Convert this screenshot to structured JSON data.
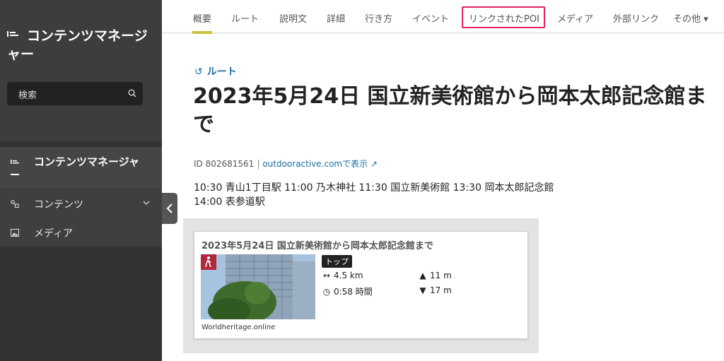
{
  "sidebar": {
    "title": "コンテンツマネージャー",
    "search_placeholder": "検索",
    "section_label": "コンテンツマネージャ",
    "items": [
      {
        "label": "コンテンツ",
        "icon": "content-icon"
      },
      {
        "label": "メディア",
        "icon": "image-icon"
      }
    ]
  },
  "tabs": [
    {
      "label": "概要",
      "active": true
    },
    {
      "label": "ルート"
    },
    {
      "label": "説明文"
    },
    {
      "label": "詳細"
    },
    {
      "label": "行き方"
    },
    {
      "label": "イベント"
    },
    {
      "label": "リンクされたPOI",
      "highlighted": true
    },
    {
      "label": "メディア"
    },
    {
      "label": "外部リンク"
    },
    {
      "label": "その他 ▾"
    }
  ],
  "main": {
    "back_label": "ルート",
    "title": "2023年5月24日 国立新美術館から岡本太郎記念館まで",
    "id_text": "ID 802681561",
    "external_link": "outdooractive.comで表示 ↗",
    "description": "10:30 青山1丁目駅 11:00 乃木神社 11:30 国立新美術館 13:30 岡本太郎記念館 14:00 表参道駅"
  },
  "card": {
    "title": "2023年5月24日 国立新美術館から岡本太郎記念館まで",
    "badge": "トップ",
    "distance": "4.5 km",
    "duration": "0:58 時間",
    "ascent": "11 m",
    "descent": "17 m",
    "credit": "Worldheritage.online"
  },
  "colors": {
    "sidebar_bg": "#333333",
    "link": "#1d6fa0",
    "active_tab_underline": "#c8c33c",
    "highlight_border": "#e91e63",
    "hike_badge": "#b0283a"
  }
}
